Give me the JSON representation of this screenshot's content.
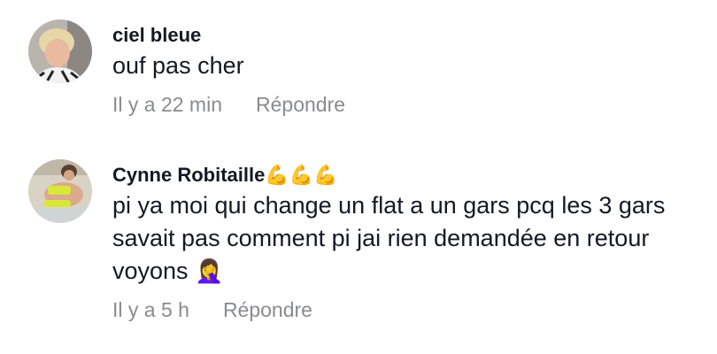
{
  "comments": [
    {
      "username": "ciel bleue",
      "text": "ouf pas cher",
      "time": "Il y a 22 min",
      "reply_label": "Répondre"
    },
    {
      "username": "Cynne Robitaille",
      "username_suffix": "💪💪💪",
      "text": "pi ya moi qui change un flat a un gars pcq les 3 gars savait pas comment pi jai rien demandée en retour voyons",
      "text_emoji": "🤦‍♀️",
      "time": "Il y a 5 h",
      "reply_label": "Répondre"
    }
  ]
}
